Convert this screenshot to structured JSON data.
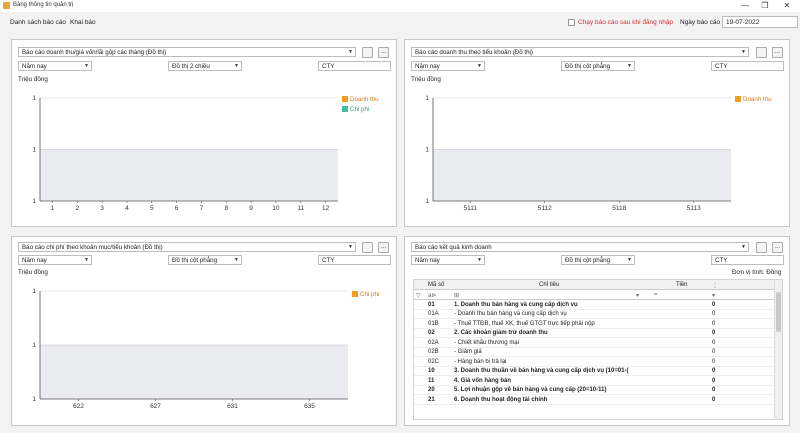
{
  "window": {
    "title": "Bảng thông tin quản trị",
    "minimize": "—",
    "restore": "❐",
    "close": "✕"
  },
  "menu": {
    "items": [
      "Danh sách báo cáo",
      "Khai báo"
    ]
  },
  "toolbar": {
    "run_on_login_label": "Chạy báo cáo sau khi đăng nhập",
    "run_on_login_checked": false,
    "report_date_label": "Ngày báo cáo",
    "report_date_value": "19-07-2022"
  },
  "colors": {
    "doanh_thu": "#f39c1e",
    "chi_phi": "#3fbf9f",
    "plot_fill": "#ebebf2",
    "accent_red": "#d32f2f"
  },
  "panels": [
    {
      "report_select": "Báo cáo doanh thu/giá vốn/lãi gộp các tháng (Đồ thị)",
      "period_select": "Năm nay",
      "chart_type_select": "Đồ thị 2 chiều",
      "company_value": "CTY",
      "unit_label": "Triệu đồng",
      "btn_open": "",
      "btn_more": "...",
      "chart_data": {
        "type": "area",
        "categories": [
          "1",
          "2",
          "3",
          "4",
          "5",
          "6",
          "7",
          "8",
          "9",
          "10",
          "11",
          "12"
        ],
        "series": [
          {
            "name": "Doanh thu",
            "values": [
              0,
              0,
              0,
              0,
              0,
              0,
              0,
              0,
              0,
              0,
              0,
              0
            ]
          },
          {
            "name": "Chi phí",
            "values": [
              0,
              0,
              0,
              0,
              0,
              0,
              0,
              0,
              0,
              0,
              0,
              0
            ]
          }
        ],
        "yticks": [
          "1",
          "1",
          "1"
        ],
        "legend_position": "right"
      }
    },
    {
      "report_select": "Báo cáo doanh thu theo tiểu khoản (Đồ thị)",
      "period_select": "Năm nay",
      "chart_type_select": "Đồ thị cột phẳng",
      "company_value": "CTY",
      "unit_label": "Triệu đồng",
      "btn_open": "",
      "btn_more": "...",
      "chart_data": {
        "type": "bar",
        "categories": [
          "5111",
          "5112",
          "5118",
          "5113"
        ],
        "series": [
          {
            "name": "Doanh thu",
            "values": [
              0,
              0,
              0,
              0
            ]
          }
        ],
        "yticks": [
          "1",
          "1",
          "1"
        ],
        "legend_position": "right"
      }
    },
    {
      "report_select": "Báo cáo chi phí theo khoản mục/tiểu khoản (Đồ thị)",
      "period_select": "Năm nay",
      "chart_type_select": "Đồ thị cột phẳng",
      "company_value": "CTY",
      "unit_label": "Triệu đồng",
      "btn_open": "",
      "btn_more": "...",
      "chart_data": {
        "type": "bar",
        "categories": [
          "622",
          "627",
          "631",
          "635"
        ],
        "series": [
          {
            "name": "Chi phí",
            "values": [
              0,
              0,
              0,
              0
            ]
          }
        ],
        "yticks": [
          "1",
          "1",
          "1"
        ],
        "legend_position": "right"
      }
    },
    {
      "report_select": "Báo cáo kết quả kinh doanh",
      "period_select": "Năm nay",
      "chart_type_select": "Đồ thị cột phẳng",
      "company_value": "CTY",
      "unit_label": "Đơn vị tính: Đồng",
      "btn_open": "",
      "btn_more": "...",
      "table": {
        "headers": [
          "Mã số",
          "Chỉ tiêu",
          "Tiền"
        ],
        "filter": {
          "row_icon": "▽",
          "ma_so": "a⊳",
          "chi_tieu": "⊞",
          "tien": "="
        },
        "rows": [
          {
            "ma": "01",
            "name": "1. Doanh thu bán hàng và cung cấp dịch vụ",
            "tien": "0",
            "bold": true
          },
          {
            "ma": "01A",
            "name": "- Doanh thu bán hàng và cung cấp dịch vụ",
            "tien": "0",
            "bold": false
          },
          {
            "ma": "01B",
            "name": "- Thuế TTĐB, thuế XK, thuế GTGT trực tiếp phải nộp",
            "tien": "0",
            "bold": false
          },
          {
            "ma": "02",
            "name": "2. Các khoản giảm trừ doanh thu",
            "tien": "0",
            "bold": true
          },
          {
            "ma": "02A",
            "name": "- Chiết khấu thương mại",
            "tien": "0",
            "bold": false
          },
          {
            "ma": "02B",
            "name": "- Giảm giá",
            "tien": "0",
            "bold": false
          },
          {
            "ma": "02C",
            "name": "- Hàng bán bị trả lại",
            "tien": "0",
            "bold": false
          },
          {
            "ma": "10",
            "name": "3. Doanh thu thuần về bán hàng và cung cấp dịch vụ (10=01-(",
            "tien": "0",
            "bold": true
          },
          {
            "ma": "11",
            "name": "4. Giá vốn hàng bán",
            "tien": "0",
            "bold": true
          },
          {
            "ma": "20",
            "name": "5. Lợi nhuận gộp về bán hàng và cung cấp (20=10-11)",
            "tien": "0",
            "bold": true
          },
          {
            "ma": "21",
            "name": "6. Doanh thu hoạt động tài chính",
            "tien": "0",
            "bold": true
          }
        ]
      }
    }
  ]
}
